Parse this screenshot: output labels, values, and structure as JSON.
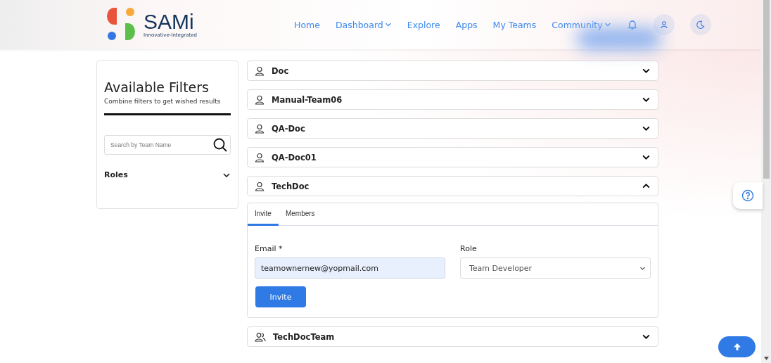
{
  "logo": {
    "name": "SAMi",
    "tagline": "Innovative-Integrated"
  },
  "nav": [
    {
      "label": "Home",
      "dropdown": false
    },
    {
      "label": "Dashboard",
      "dropdown": true
    },
    {
      "label": "Explore",
      "dropdown": false
    },
    {
      "label": "Apps",
      "dropdown": false
    },
    {
      "label": "My Teams",
      "dropdown": false
    },
    {
      "label": "Community",
      "dropdown": true
    }
  ],
  "filters": {
    "title": "Available Filters",
    "subtitle": "Combine filters to get wished results",
    "search_placeholder": "Search by Team Name",
    "sections": [
      {
        "label": "Roles",
        "expanded": false
      }
    ]
  },
  "teams": [
    {
      "name": "Doc",
      "kind": "single",
      "expanded": false
    },
    {
      "name": "Manual-Team06",
      "kind": "single",
      "expanded": false
    },
    {
      "name": "QA-Doc",
      "kind": "single",
      "expanded": false
    },
    {
      "name": "QA-Doc01",
      "kind": "single",
      "expanded": false
    },
    {
      "name": "TechDoc",
      "kind": "single",
      "expanded": true
    },
    {
      "name": "TechDocTeam",
      "kind": "group",
      "expanded": false
    }
  ],
  "panel": {
    "tabs": [
      {
        "label": "Invite",
        "selected": true
      },
      {
        "label": "Members",
        "selected": false
      }
    ],
    "email_label": "Email *",
    "email_value": "teamownernew@yopmail.com",
    "role_label": "Role",
    "role_value": "Team Developer",
    "invite_button": "Invite"
  }
}
